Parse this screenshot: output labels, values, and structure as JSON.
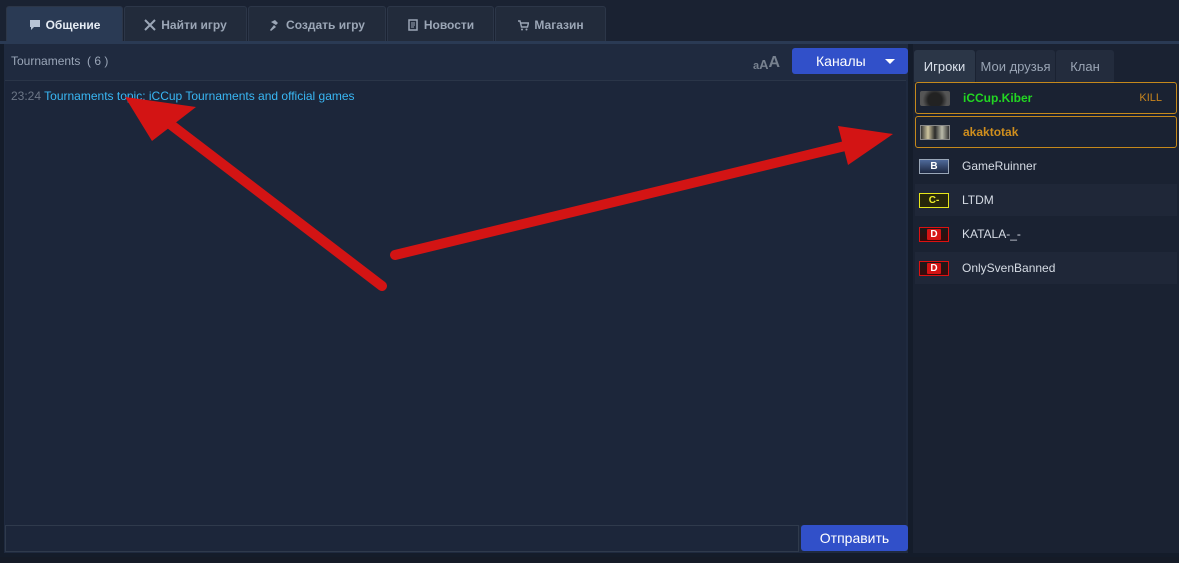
{
  "tabs": [
    {
      "label": "Общение",
      "icon": "chat-icon",
      "active": true
    },
    {
      "label": "Найти игру",
      "icon": "crossed-swords-icon",
      "active": false
    },
    {
      "label": "Создать игру",
      "icon": "hammer-icon",
      "active": false
    },
    {
      "label": "Новости",
      "icon": "newspaper-icon",
      "active": false
    },
    {
      "label": "Магазин",
      "icon": "cart-icon",
      "active": false
    }
  ],
  "chat": {
    "channel_name": "Tournaments",
    "user_count": "( 6 )",
    "font_size_glyphs": [
      "a",
      "A",
      "A"
    ],
    "channels_button": "Каналы",
    "messages": [
      {
        "time": "23:24",
        "text": "Tournaments topic: iCCup Tournaments and official games"
      }
    ],
    "send_button": "Отправить"
  },
  "players_tabs": [
    {
      "label": "Игроки",
      "active": true
    },
    {
      "label": "Мои друзья",
      "active": false
    },
    {
      "label": "Клан",
      "active": false
    }
  ],
  "players": [
    {
      "name": "iCCup.Kiber",
      "badge": "KILL",
      "rank": "",
      "name_color": "#22d622",
      "bold": true
    },
    {
      "name": "akaktotak",
      "badge": "",
      "rank": "",
      "name_color": "#cf8e1d",
      "bold": true
    },
    {
      "name": "GameRuinner",
      "badge": "",
      "rank": "B",
      "name_color": "#d5dbe4",
      "bold": false
    },
    {
      "name": "LTDM",
      "badge": "",
      "rank": "C-",
      "name_color": "#d5dbe4",
      "bold": false
    },
    {
      "name": "KATALA-_-",
      "badge": "",
      "rank": "D",
      "name_color": "#d5dbe4",
      "bold": false
    },
    {
      "name": "OnlySvenBanned",
      "badge": "",
      "rank": "D",
      "name_color": "#d5dbe4",
      "bold": false
    }
  ],
  "colors": {
    "accent": "#3150c9",
    "link": "#39b7f4",
    "highlight_border": "#c5891c",
    "annotation_arrow": "#d31414"
  }
}
